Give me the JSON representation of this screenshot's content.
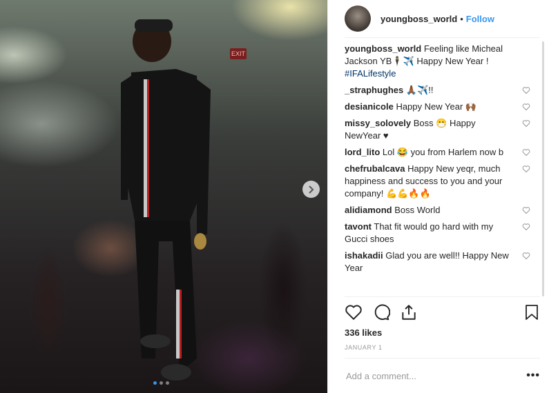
{
  "post": {
    "username": "youngboss_world",
    "follow_label": "Follow",
    "separator": "•",
    "caption_user": "youngboss_world",
    "caption_text": "Feeling like Micheal Jackson YB🕴️✈️ Happy New Year !",
    "caption_tag": "#IFALifestyle",
    "likes": "336 likes",
    "date": "JANUARY 1",
    "add_comment_placeholder": "Add a comment...",
    "more_label": "•••",
    "carousel": {
      "total_slides": 3,
      "active_slide": 1
    }
  },
  "photo": {
    "exit_sign": "EXIT"
  },
  "comments": [
    {
      "user": "_straphughes",
      "text": "🙏🏾✈️!!"
    },
    {
      "user": "desianicole",
      "text": "Happy New Year 🙌🏾"
    },
    {
      "user": "missy_solovely",
      "text": "Boss 😷 Happy NewYear ♥"
    },
    {
      "user": "lord_lito",
      "text": "Lol 😂 you from Harlem now b"
    },
    {
      "user": "chefrubalcava",
      "text": "Happy New yeqr, much happiness and success to you and your company! 💪💪🔥🔥"
    },
    {
      "user": "alidiamond",
      "text": "Boss World"
    },
    {
      "user": "tavont",
      "text": "That fit would go hard with my Gucci shoes"
    },
    {
      "user": "ishakadii",
      "text": "Glad you are well!! Happy New Year"
    }
  ],
  "colors": {
    "accent": "#3897f0",
    "text": "#262626",
    "muted": "#999999",
    "border": "#efefef"
  },
  "icons": [
    "chevron-right-icon",
    "heart-icon",
    "comment-icon",
    "share-icon",
    "bookmark-icon",
    "more-icon"
  ]
}
